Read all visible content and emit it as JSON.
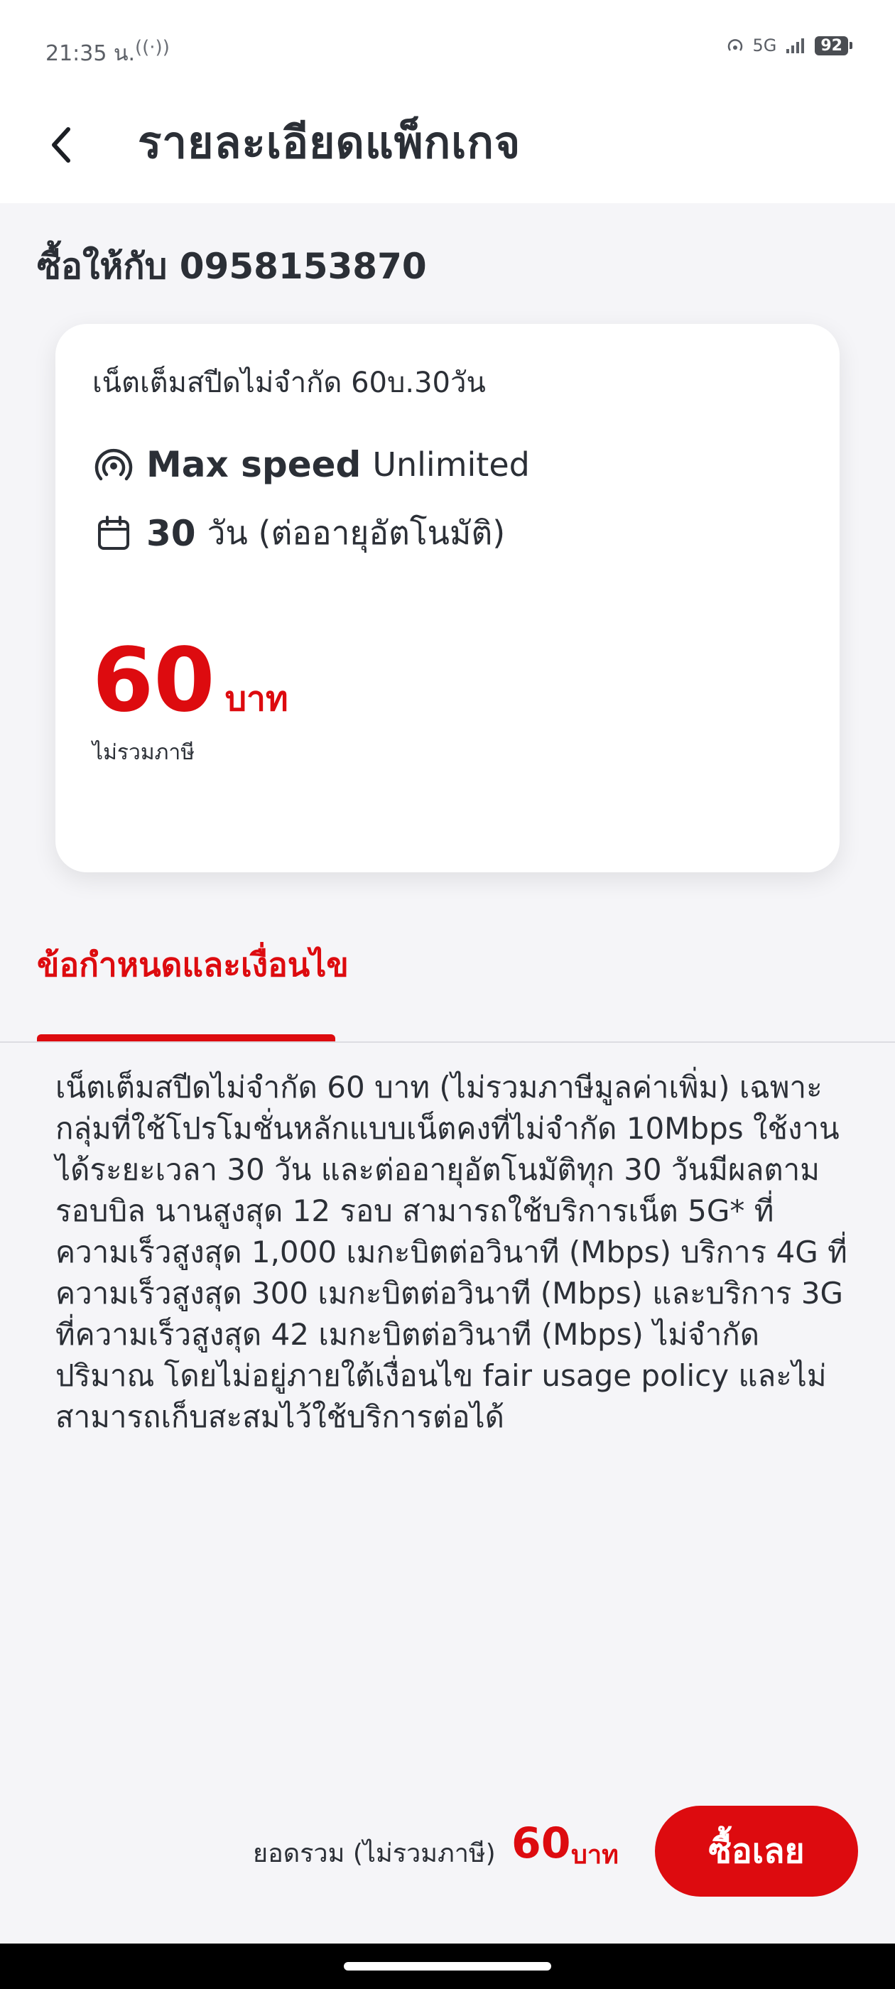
{
  "status_bar": {
    "time": "21:35 น.",
    "wifi_symbol": "((·))",
    "network": "5G",
    "battery": "92"
  },
  "header": {
    "title": "รายละเอียดแพ็กเกจ"
  },
  "buy_for": "ซื้อให้กับ 0958153870",
  "package": {
    "name": "เน็ตเต็มสปีดไม่จำกัด 60บ.30วัน",
    "speed_strong": "Max speed",
    "speed_value": "Unlimited",
    "days_strong": "30",
    "days_text": "วัน (ต่ออายุอัตโนมัติ)",
    "price_value": "60",
    "price_unit": "บาท",
    "price_note": "ไม่รวมภาษี"
  },
  "terms": {
    "title": "ข้อกำหนดและเงื่อนไข",
    "body": "เน็ตเต็มสปีดไม่จำกัด 60 บาท (ไม่รวมภาษีมูลค่าเพิ่ม) เฉพาะกลุ่มที่ใช้โปรโมชั่นหลักแบบเน็ตคงที่ไม่จำกัด 10Mbps ใช้งานได้ระยะเวลา 30 วัน และต่ออายุอัตโนมัติทุก 30 วันมีผลตามรอบบิล นานสูงสุด 12 รอบ สามารถใช้บริการเน็ต 5G* ที่ความเร็วสูงสุด 1,000 เมกะบิตต่อวินาที (Mbps) บริการ 4G ที่ความเร็วสูงสุด 300 เมกะบิตต่อวินาที (Mbps) และบริการ 3G ที่ความเร็วสูงสุด 42 เมกะบิตต่อวินาที (Mbps) ไม่จำกัดปริมาณ โดยไม่อยู่ภายใต้เงื่อนไข fair usage policy และไม่สามารถเก็บสะสมไว้ใช้บริการต่อได้"
  },
  "footer": {
    "total_label": "ยอดรวม (ไม่รวมภาษี)",
    "total_value": "60",
    "total_unit": "บาท",
    "buy_button": "ซื้อเลย"
  },
  "colors": {
    "accent": "#dd0b0f",
    "text": "#2b2f36",
    "background": "#f5f5f8"
  },
  "icons": {
    "back": "chevron-left-icon",
    "speed": "signal-waves-icon",
    "calendar": "calendar-icon"
  }
}
